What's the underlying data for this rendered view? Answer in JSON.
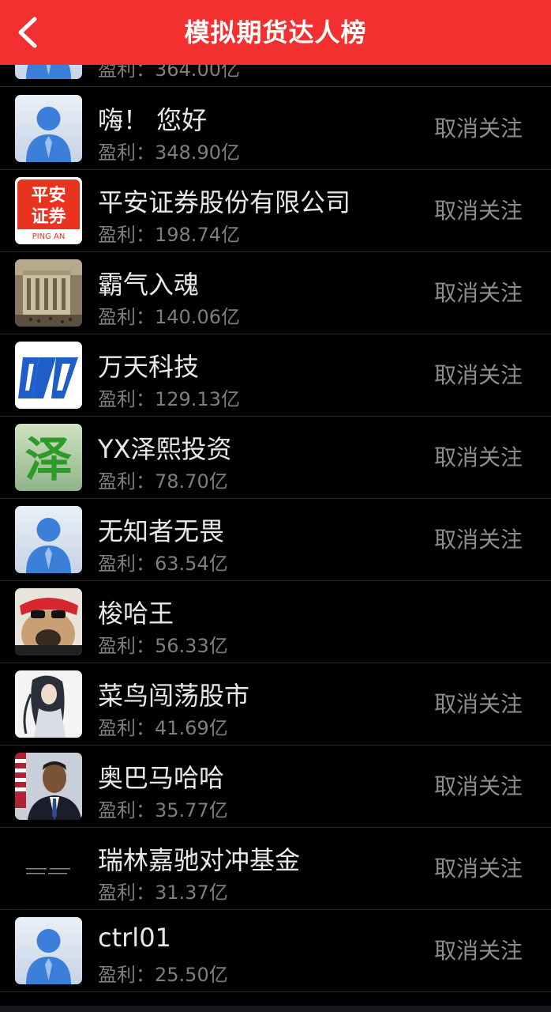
{
  "header": {
    "title": "模拟期货达人榜"
  },
  "labels": {
    "profit_prefix": "盈利：",
    "unfollow": "取消关注"
  },
  "rows": [
    {
      "name": "",
      "profit": "364.00亿",
      "unfollow": "",
      "avatar": "default-avatar-icon"
    },
    {
      "name": "嗨！ 您好",
      "profit": "348.90亿",
      "unfollow": "取消关注",
      "avatar": "default-avatar-icon"
    },
    {
      "name": "平安证券股份有限公司",
      "profit": "198.74亿",
      "unfollow": "取消关注",
      "avatar": "pingan-logo-icon"
    },
    {
      "name": "霸气入魂",
      "profit": "140.06亿",
      "unfollow": "取消关注",
      "avatar": "building-photo-icon"
    },
    {
      "name": "万天科技",
      "profit": "129.13亿",
      "unfollow": "取消关注",
      "avatar": "wantian-logo-icon"
    },
    {
      "name": "YX泽熙投资",
      "profit": "78.70亿",
      "unfollow": "取消关注",
      "avatar": "ze-character-icon"
    },
    {
      "name": "无知者无畏",
      "profit": "63.54亿",
      "unfollow": "取消关注",
      "avatar": "default-avatar-icon"
    },
    {
      "name": "梭哈王",
      "profit": "56.33亿",
      "unfollow": "",
      "avatar": "pug-photo-icon"
    },
    {
      "name": "菜鸟闯荡股市",
      "profit": "41.69亿",
      "unfollow": "取消关注",
      "avatar": "illustrated-portrait-icon"
    },
    {
      "name": "奥巴马哈哈",
      "profit": "35.77亿",
      "unfollow": "取消关注",
      "avatar": "man-portrait-icon"
    },
    {
      "name": "瑞林嘉驰对冲基金",
      "profit": "31.37亿",
      "unfollow": "取消关注",
      "avatar": "black-text-icon"
    },
    {
      "name": "ctrl01",
      "profit": "25.50亿",
      "unfollow": "取消关注",
      "avatar": "default-avatar-icon"
    }
  ],
  "colors": {
    "nav_bg": "#f23030",
    "page_bg": "#000000",
    "name_text": "#e8e8e8",
    "secondary_text": "#7e7e80"
  }
}
